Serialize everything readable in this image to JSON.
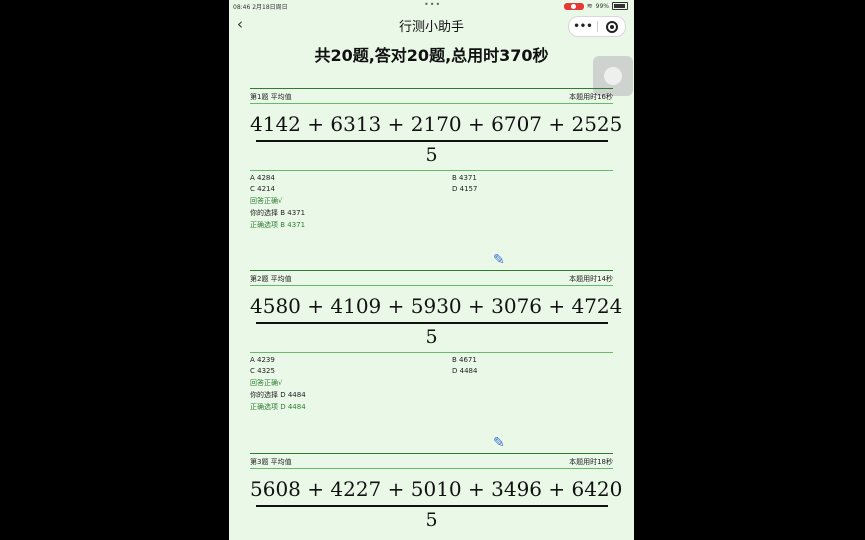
{
  "status": {
    "time": "08:46 2月18日周日",
    "battery": "99%"
  },
  "nav": {
    "back_icon": "‹",
    "title": "行测小助手",
    "more_icon": "•••"
  },
  "summary": "共20题,答对20题,总用时370秒",
  "questions": [
    {
      "label": "第1题 平均值",
      "time": "本题用时16秒",
      "numerator": "4142 + 6313 + 2170 + 6707 + 2525",
      "denominator": "5",
      "options": {
        "A": "A 4284",
        "B": "B 4371",
        "C": "C 4214",
        "D": "D 4157"
      },
      "result": "回答正确√",
      "your_choice": "你的选择 B 4371",
      "correct_option": "正确选项 B 4371"
    },
    {
      "label": "第2题 平均值",
      "time": "本题用时14秒",
      "numerator": "4580 + 4109 + 5930 + 3076 + 4724",
      "denominator": "5",
      "options": {
        "A": "A 4239",
        "B": "B 4671",
        "C": "C 4325",
        "D": "D 4484"
      },
      "result": "回答正确√",
      "your_choice": "你的选择 D 4484",
      "correct_option": "正确选项 D 4484"
    },
    {
      "label": "第3题 平均值",
      "time": "本题用时18秒",
      "numerator": "5608 + 4227 + 5010 + 3496 + 6420",
      "denominator": "5"
    }
  ],
  "icons": {
    "pen": "pen-icon",
    "float": "assistive-touch-icon"
  },
  "colors": {
    "background": "#eaf8e8",
    "accent": "#2e7d32"
  }
}
